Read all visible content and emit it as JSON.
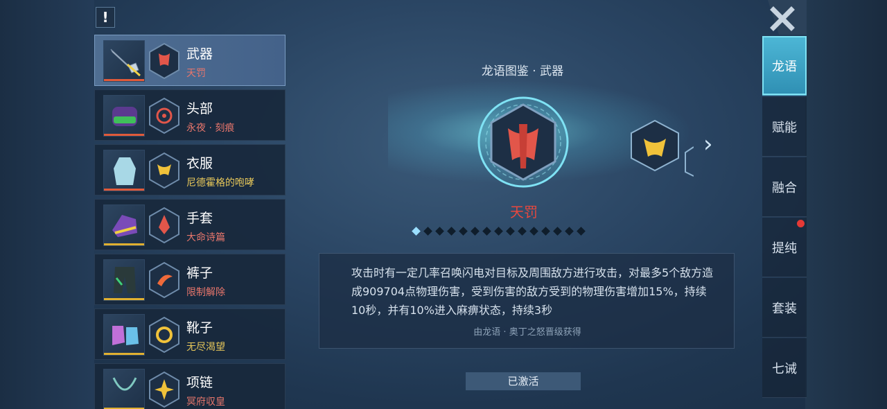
{
  "alert": {
    "symbol": "!"
  },
  "equipment": [
    {
      "name": "武器",
      "set": "天罚",
      "set_color": "#e8766c",
      "bar_color": "#e05a3a",
      "selected": true
    },
    {
      "name": "头部",
      "set": "永夜 · 刻痕",
      "set_color": "#e8766c",
      "bar_color": "#e05a3a",
      "selected": false
    },
    {
      "name": "衣服",
      "set": "尼德霍格的咆哮",
      "set_color": "#e8c85a",
      "bar_color": "#e05a3a",
      "selected": false
    },
    {
      "name": "手套",
      "set": "大命诗篇",
      "set_color": "#e8766c",
      "bar_color": "#e0b030",
      "selected": false
    },
    {
      "name": "裤子",
      "set": "限制解除",
      "set_color": "#e8766c",
      "bar_color": "#e0b030",
      "selected": false
    },
    {
      "name": "靴子",
      "set": "无尽渴望",
      "set_color": "#e8c85a",
      "bar_color": "#e0b030",
      "selected": false
    },
    {
      "name": "项链",
      "set": "冥府収皇",
      "set_color": "#e8766c",
      "bar_color": "#e0b030",
      "selected": false
    }
  ],
  "codex": {
    "title": "龙语图鉴 · 武器",
    "item_name": "天罚",
    "pages_total": 15,
    "page_current": 1,
    "description": "攻击时有一定几率召唤闪电对目标及周围敌方进行攻击，对最多5个敌方造成909704点物理伤害，受到伤害的敌方受到的物理伤害增加15%，持续10秒，并有10%进入麻痹状态，持续3秒",
    "source": "由龙语 · 奥丁之怒晋级获得",
    "status_button": "已激活"
  },
  "tabs": [
    {
      "label": "龙语",
      "active": true
    },
    {
      "label": "赋能",
      "active": false
    },
    {
      "label": "融合",
      "active": false
    },
    {
      "label": "提纯",
      "active": false,
      "notification": true
    },
    {
      "label": "套装",
      "active": false
    },
    {
      "label": "七诫",
      "active": false
    }
  ],
  "close": {
    "icon": "close-x-icon"
  },
  "colors": {
    "accent": "#4db7d6",
    "item_name": "#e8483e"
  }
}
